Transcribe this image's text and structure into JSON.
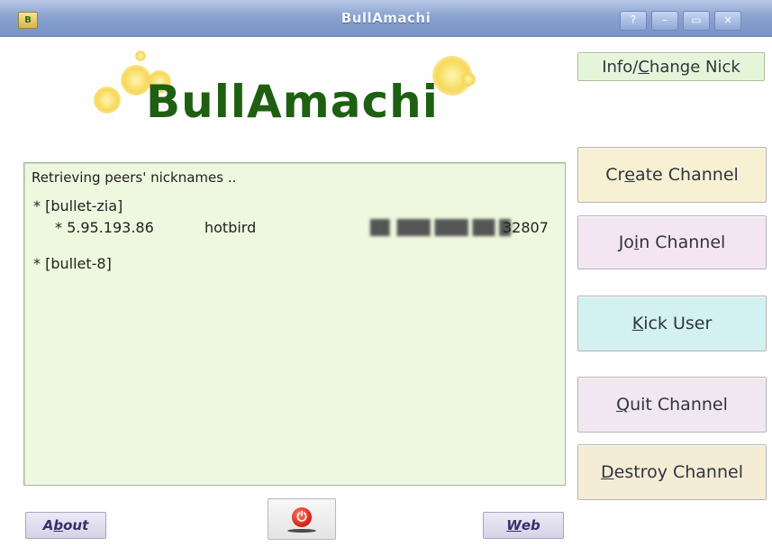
{
  "window": {
    "title": "BullAmachi",
    "controls": [
      "?",
      "–",
      "▭",
      "×"
    ]
  },
  "logo": {
    "text": "BullAmachi"
  },
  "log": {
    "lines": [
      "Retrieving peers' nicknames ..",
      "* [bullet-zia]",
      "* 5.95.193.86",
      "hotbird",
      "32807",
      "* [bullet-8]"
    ]
  },
  "buttons": {
    "info_nick": {
      "before": "Info/",
      "key": "C",
      "after": "hange Nick"
    },
    "create_channel": {
      "before": "Cr",
      "key": "e",
      "after": "ate Channel"
    },
    "join_channel": {
      "before": "Jo",
      "key": "i",
      "after": "n Channel"
    },
    "kick_user": {
      "before": "",
      "key": "K",
      "after": "ick User"
    },
    "quit_channel": {
      "before": "",
      "key": "Q",
      "after": "uit Channel"
    },
    "destroy_channel": {
      "before": "",
      "key": "D",
      "after": "estroy Channel"
    },
    "about": {
      "before": "A",
      "key": "b",
      "after": "out"
    },
    "web": {
      "before": "",
      "key": "W",
      "after": "eb"
    }
  },
  "colors": {
    "log_background": "#edf8de",
    "create_button": "#f8f0d3",
    "join_button": "#f4e6f1",
    "kick_button": "#d3f1f1",
    "quit_button": "#f1e7f1",
    "destroy_button": "#f5ecd6",
    "info_button": "#e6f4da",
    "logo_text": "#1f5f12"
  },
  "icons": {
    "app": "bullamachi-app-icon",
    "power": "power-icon"
  }
}
